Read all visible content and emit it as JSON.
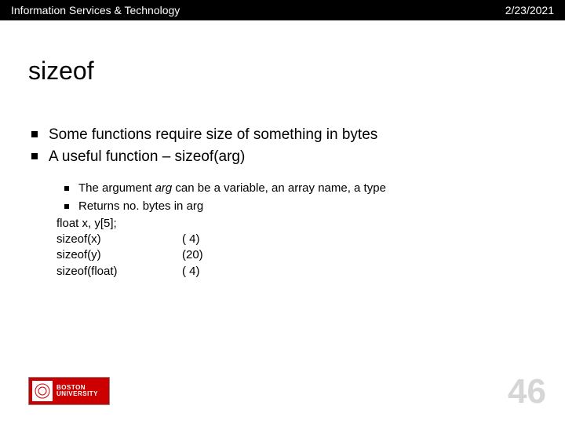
{
  "header": {
    "left": "Information Services & Technology",
    "right": "2/23/2021"
  },
  "title": "sizeof",
  "main_bullets": [
    "Some functions require size of something in bytes",
    "A useful function – sizeof(arg)"
  ],
  "sub_bullets": [
    {
      "pre": "The argument ",
      "ital": "arg",
      "post": " can be a variable, an array name, a type"
    },
    {
      "pre": "Returns no. bytes in arg",
      "ital": "",
      "post": ""
    }
  ],
  "code_decl": "float x, y[5];",
  "code_rows": [
    {
      "left": "sizeof(x)",
      "right": "(  4)"
    },
    {
      "left": "sizeof(y)",
      "right": "(20)"
    },
    {
      "left": "sizeof(float)",
      "right": "(  4)"
    }
  ],
  "logo": {
    "line1": "BOSTON",
    "line2": "UNIVERSITY"
  },
  "page_number": "46"
}
